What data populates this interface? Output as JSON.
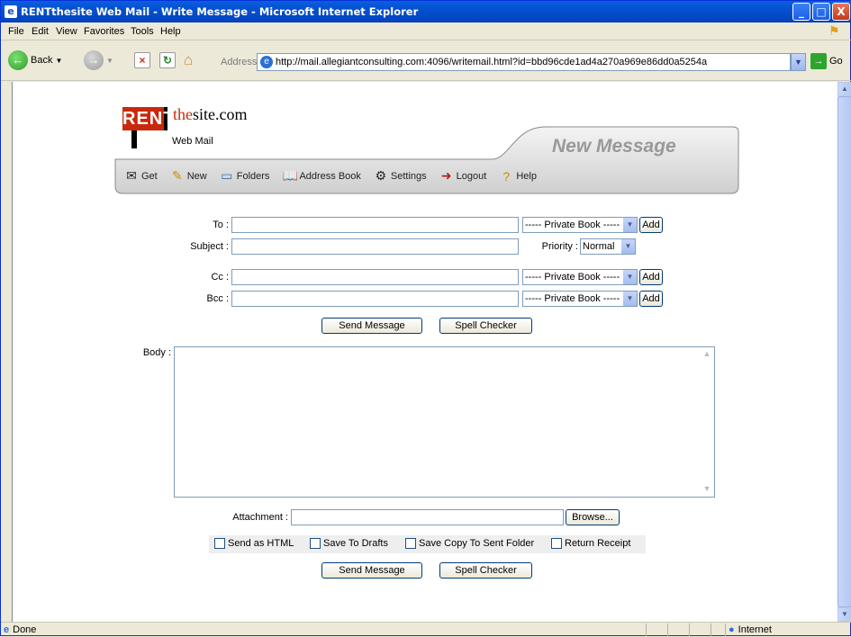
{
  "window": {
    "title": "RENTthesite Web Mail - Write Message - Microsoft Internet Explorer",
    "min": "_",
    "max": "□",
    "close": "X"
  },
  "menu": [
    "File",
    "Edit",
    "View",
    "Favorites",
    "Tools",
    "Help"
  ],
  "toolbar": {
    "back": "Back",
    "address_label": "Address",
    "address_url": "http://mail.allegiantconsulting.com:4096/writemail.html?id=bbd96cde1ad4a270a969e86dd0a5254a",
    "go": "Go"
  },
  "logo": {
    "rent": "RENT",
    "the": "the",
    "site": "site.com",
    "sub": "Web Mail"
  },
  "header": {
    "title": "New Message"
  },
  "nav": [
    {
      "label": "Get",
      "icon": "get-mail-icon"
    },
    {
      "label": "New",
      "icon": "new-message-icon"
    },
    {
      "label": "Folders",
      "icon": "folders-icon"
    },
    {
      "label": "Address Book",
      "icon": "address-book-icon"
    },
    {
      "label": "Settings",
      "icon": "settings-icon"
    },
    {
      "label": "Logout",
      "icon": "logout-icon"
    },
    {
      "label": "Help",
      "icon": "help-icon"
    }
  ],
  "form": {
    "to_label": "To :",
    "subject_label": "Subject :",
    "cc_label": "Cc :",
    "bcc_label": "Bcc :",
    "body_label": "Body :",
    "attachment_label": "Attachment :",
    "to_value": "",
    "subject_value": "",
    "cc_value": "",
    "bcc_value": "",
    "book_select": "----- Private Book -----",
    "add": "Add",
    "priority_label": "Priority :",
    "priority_value": "Normal",
    "send": "Send Message",
    "spell": "Spell Checker",
    "browse": "Browse..."
  },
  "options": {
    "html": "Send as HTML",
    "drafts": "Save To Drafts",
    "sent": "Save Copy To Sent Folder",
    "receipt": "Return Receipt"
  },
  "status": {
    "left": "Done",
    "zone": "Internet"
  }
}
